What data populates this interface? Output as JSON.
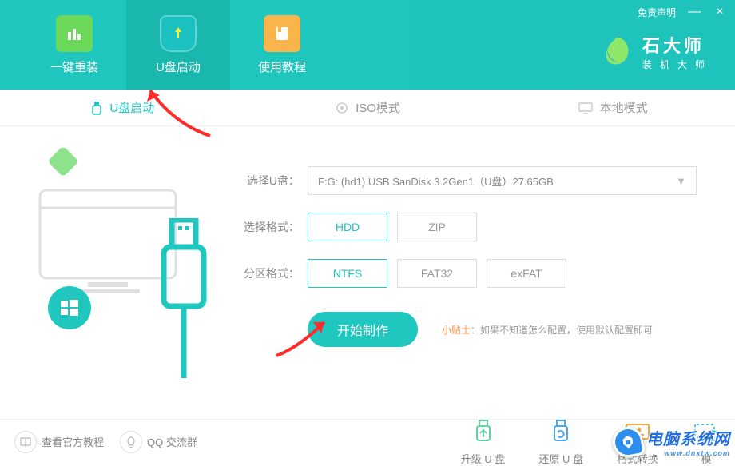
{
  "top": {
    "disclaimer": "免责声明",
    "minimize": "—",
    "close": "×"
  },
  "nav": {
    "tab1": "一键重装",
    "tab2": "U盘启动",
    "tab3": "使用教程"
  },
  "logo": {
    "title": "石大师",
    "sub": "装机大师"
  },
  "subtabs": {
    "usb": "U盘启动",
    "iso": "ISO模式",
    "local": "本地模式"
  },
  "form": {
    "select_label": "选择U盘：",
    "select_value": "F:G: (hd1)  USB SanDisk 3.2Gen1（U盘）27.65GB",
    "format_label": "选择格式：",
    "hdd": "HDD",
    "zip": "ZIP",
    "partition_label": "分区格式：",
    "ntfs": "NTFS",
    "fat32": "FAT32",
    "exfat": "exFAT",
    "start": "开始制作",
    "tip_label": "小贴士：",
    "tip_text": "如果不知道怎么配置，使用默认配置即可"
  },
  "bottom_links": {
    "tutorial": "查看官方教程",
    "qq": "QQ 交流群"
  },
  "bottom_actions": {
    "upgrade": "升级 U 盘",
    "restore": "还原 U 盘",
    "convert": "格式转换",
    "simulate": "模"
  },
  "watermark": {
    "main": "电脑系统网",
    "sub": "www.dnxtw.com"
  }
}
